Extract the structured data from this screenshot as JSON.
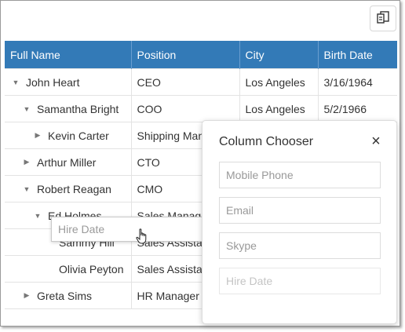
{
  "toolbar": {
    "column_chooser_icon": "column-chooser-icon"
  },
  "columns": [
    "Full Name",
    "Position",
    "City",
    "Birth Date"
  ],
  "rows": [
    {
      "indent": 0,
      "arrow": "expanded",
      "name": "John Heart",
      "position": "CEO",
      "city": "Los Angeles",
      "birth": "3/16/1964"
    },
    {
      "indent": 1,
      "arrow": "expanded",
      "name": "Samantha Bright",
      "position": "COO",
      "city": "Los Angeles",
      "birth": "5/2/1966"
    },
    {
      "indent": 2,
      "arrow": "collapsed",
      "name": "Kevin Carter",
      "position": "Shipping Manager",
      "city": "",
      "birth": ""
    },
    {
      "indent": 1,
      "arrow": "collapsed",
      "name": "Arthur Miller",
      "position": "CTO",
      "city": "",
      "birth": ""
    },
    {
      "indent": 1,
      "arrow": "expanded",
      "name": "Robert Reagan",
      "position": "CMO",
      "city": "",
      "birth": ""
    },
    {
      "indent": 2,
      "arrow": "expanded",
      "name": "Ed Holmes",
      "position": "Sales Manager",
      "city": "",
      "birth": ""
    },
    {
      "indent": 3,
      "arrow": "none",
      "name": "Sammy Hill",
      "position": "Sales Assistant",
      "city": "",
      "birth": ""
    },
    {
      "indent": 3,
      "arrow": "none",
      "name": "Olivia Peyton",
      "position": "Sales Assistant",
      "city": "",
      "birth": ""
    },
    {
      "indent": 1,
      "arrow": "collapsed",
      "name": "Greta Sims",
      "position": "HR Manager",
      "city": "",
      "birth": ""
    }
  ],
  "chooser": {
    "title": "Column Chooser",
    "close": "×",
    "items": [
      "Mobile Phone",
      "Email",
      "Skype",
      "Hire Date"
    ]
  },
  "drag": {
    "label": "Hire Date"
  },
  "colors": {
    "header": "#337ab7",
    "border": "#e3e3e3"
  }
}
